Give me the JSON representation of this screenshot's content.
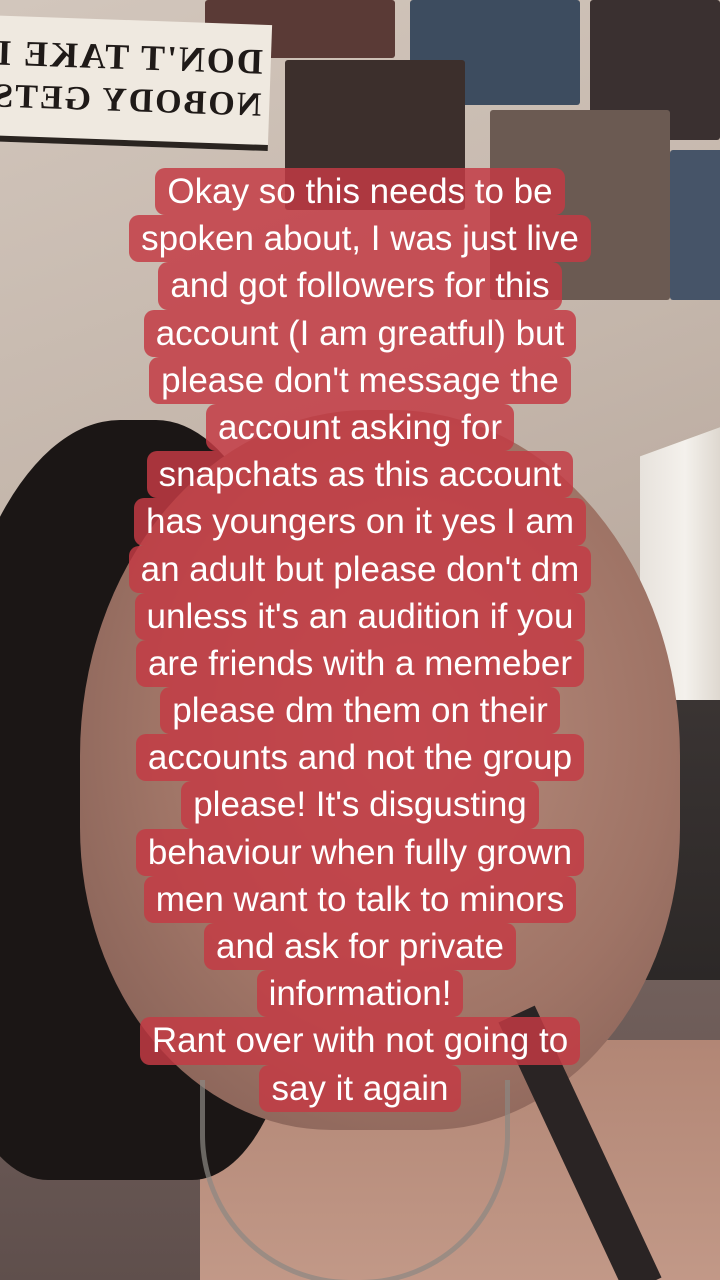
{
  "background": {
    "sign_lines": [
      "DON'T TAKE L",
      "NOBODY GETS"
    ],
    "overlay_color": "#c43a44"
  },
  "caption": {
    "lines": [
      "Okay so this needs to be",
      "spoken about, I was just live",
      "and got followers for this",
      "account (I am greatful) but",
      "please don't message the",
      "account asking for",
      "snapchats as this account",
      "has youngers on it yes I am",
      "an adult but please don't dm",
      "unless it's an audition if you",
      "are friends with a memeber",
      "please dm them on their",
      "accounts and not the group",
      "please! It's disgusting",
      "behaviour when fully grown",
      "men want to talk to minors",
      "and ask for private",
      "information!",
      "Rant over with not going to",
      "say it again"
    ]
  }
}
